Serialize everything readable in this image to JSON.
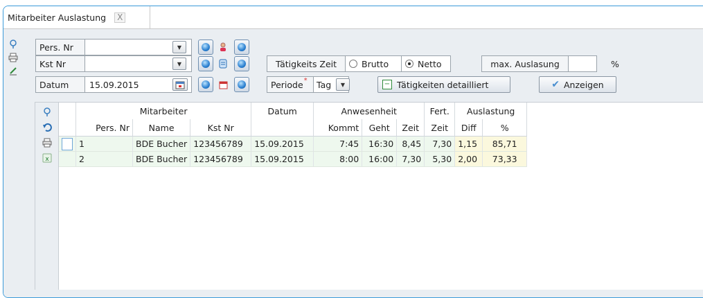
{
  "tab": {
    "title": "Mitarbeiter Auslastung",
    "close": "X"
  },
  "form": {
    "pers_nr_label": "Pers. Nr",
    "pers_nr_value": "",
    "kst_nr_label": "Kst Nr",
    "kst_nr_value": "",
    "datum_label": "Datum",
    "datum_value": "15.09.2015",
    "taetigkeits_zeit_label": "Tätigkeits Zeit",
    "brutto_label": "Brutto",
    "netto_label": "Netto",
    "selected_zeit": "Netto",
    "max_auslastung_label": "max. Auslasung",
    "max_auslastung_value": "",
    "percent_unit": "%",
    "periode_label": "Periode",
    "periode_value": "Tag",
    "taetigkeiten_label": "Tätigkeiten detailliert",
    "anzeigen_label": "Anzeigen"
  },
  "grid": {
    "group_headers": {
      "mitarbeiter": "Mitarbeiter",
      "datum": "Datum",
      "anwesenheit": "Anwesenheit",
      "fert": "Fert.",
      "auslastung": "Auslastung"
    },
    "columns": [
      "Pers. Nr",
      "Name",
      "Kst Nr",
      "Kommt",
      "Geht",
      "Zeit",
      "Zeit",
      "Diff",
      "%"
    ],
    "rows": [
      {
        "pers_nr": "1",
        "name": "BDE Bucher",
        "kst_nr": "123456789",
        "datum": "15.09.2015",
        "kommt": "7:45",
        "geht": "16:30",
        "zeit": "8,45",
        "fert_zeit": "7,30",
        "diff": "1,15",
        "pct": "85,71"
      },
      {
        "pers_nr": "2",
        "name": "BDE Bucher",
        "kst_nr": "123456789",
        "datum": "15.09.2015",
        "kommt": "8:00",
        "geht": "16:00",
        "zeit": "7,30",
        "fert_zeit": "5,30",
        "diff": "2,00",
        "pct": "73,33"
      }
    ]
  },
  "colors": {
    "accent": "#3a9ad9",
    "row_bg": "#eef8ee",
    "highlight": "#fbf8dd"
  }
}
